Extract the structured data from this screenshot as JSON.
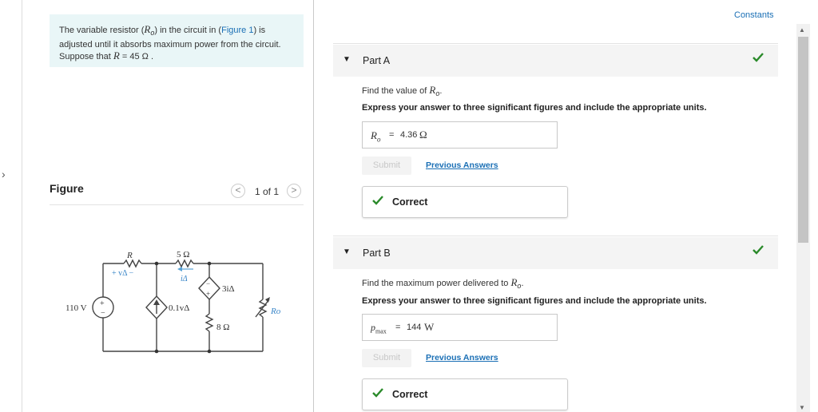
{
  "intro": {
    "line1_pre": "The variable resistor (",
    "line1_var": "R",
    "line1_sub": "o",
    "line1_mid": ") in the circuit in (",
    "line1_link": "Figure 1",
    "line1_post": ") is",
    "line2": "adjusted until it absorbs maximum power from the circuit.",
    "line3_pre": "Suppose that ",
    "line3_var": "R",
    "line3_post": " = 45  Ω ."
  },
  "figure": {
    "title": "Figure",
    "page_indicator": "1 of 1",
    "prev_glyph": "<",
    "next_glyph": ">",
    "circuit": {
      "labels": {
        "R": "R",
        "R_5": "5 Ω",
        "v_delta": "+ vΔ −",
        "i_delta": "iΔ",
        "src_110": "110 V",
        "plus": "+",
        "minus": "−",
        "dep_current": "0.1vΔ",
        "dep_voltage": "3iΔ",
        "R_8": "8 Ω",
        "R_o": "Ro"
      }
    }
  },
  "constants_link": "Constants",
  "part_a": {
    "label": "Part A",
    "question_pre": "Find the value of ",
    "question_var": "R",
    "question_sub": "o",
    "question_post": ".",
    "instruction": "Express your answer to three significant figures and include the appropriate units.",
    "answer_label": "Ro",
    "answer_eq": "=",
    "answer_value": "4.36",
    "answer_unit": "Ω",
    "submit": "Submit",
    "previous_answers": "Previous Answers",
    "feedback": "Correct"
  },
  "part_b": {
    "label": "Part B",
    "question_pre": "Find the maximum power delivered to ",
    "question_var": "R",
    "question_sub": "o",
    "question_post": ".",
    "instruction": "Express your answer to three significant figures and include the appropriate units.",
    "answer_label": "pmax",
    "answer_eq": "=",
    "answer_value": "144",
    "answer_unit": "W",
    "submit": "Submit",
    "previous_answers": "Previous Answers",
    "feedback": "Correct"
  },
  "colors": {
    "accent": "#1a6fb5",
    "check": "#2a8a2a",
    "intro_bg": "#e9f6f7"
  },
  "icons": {
    "collapse": "triangle-down-icon",
    "check": "checkmark-icon",
    "nav_left": "chevron-left-icon",
    "nav_right": "chevron-right-icon"
  }
}
